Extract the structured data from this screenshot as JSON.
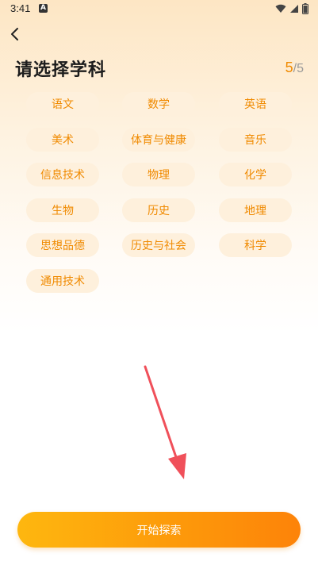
{
  "status_bar": {
    "time": "3:41",
    "notification_icon_letter": "A",
    "icons": [
      "wifi-icon",
      "signal-icon",
      "battery-icon"
    ]
  },
  "header": {
    "back_icon": "chevron-left-icon",
    "title": "请选择学科",
    "pager_current": "5",
    "pager_separator": "/",
    "pager_total": "5"
  },
  "subjects": [
    "语文",
    "数学",
    "英语",
    "美术",
    "体育与健康",
    "音乐",
    "信息技术",
    "物理",
    "化学",
    "生物",
    "历史",
    "地理",
    "思想品德",
    "历史与社会",
    "科学",
    "通用技术"
  ],
  "start_button_label": "开始探索",
  "colors": {
    "accent": "#F08A00",
    "chip_bg": "#FEF0DC",
    "button_start": "#FEB70F",
    "button_end": "#FD8309",
    "arrow": "#F0505A"
  }
}
